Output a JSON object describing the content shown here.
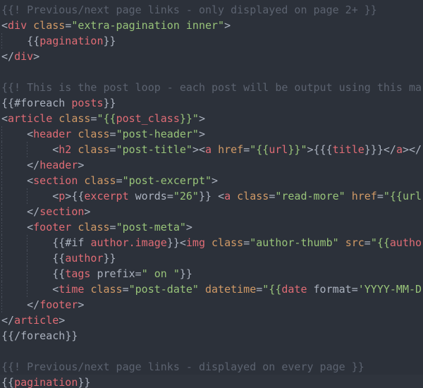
{
  "editor": {
    "theme_name": "one-dark",
    "background": "#2c313a",
    "colors": {
      "comment": "#5c6370",
      "tag": "#e06c75",
      "attribute": "#d19a66",
      "string": "#98c379",
      "punctuation": "#abb2bf",
      "variable": "#e06c75",
      "plain": "#abb2bf",
      "cursor_line": "#2f343d",
      "indent_guide": "#5c6370"
    },
    "language": "handlebars",
    "font_size_px": 15,
    "line_height_px": 22
  },
  "lines": [
    {
      "n": 1,
      "indent": 0,
      "guides": [],
      "cursor_line": false,
      "tokens": [
        {
          "c": "t-comment",
          "s": "{{! Previous/next page links - only displayed on page 2+ }}"
        }
      ]
    },
    {
      "n": 2,
      "indent": 0,
      "guides": [],
      "cursor_line": false,
      "tokens": [
        {
          "c": "t-punct",
          "s": "<"
        },
        {
          "c": "t-tag",
          "s": "div"
        },
        {
          "c": "t-plain",
          "s": " "
        },
        {
          "c": "t-attr",
          "s": "class"
        },
        {
          "c": "t-punct",
          "s": "="
        },
        {
          "c": "t-string",
          "s": "\"extra-pagination inner\""
        },
        {
          "c": "t-punct",
          "s": ">"
        }
      ]
    },
    {
      "n": 3,
      "indent": 1,
      "guides": [
        0
      ],
      "cursor_line": false,
      "tokens": [
        {
          "c": "t-punct",
          "s": "    {{"
        },
        {
          "c": "t-var",
          "s": "pagination"
        },
        {
          "c": "t-punct",
          "s": "}}"
        }
      ]
    },
    {
      "n": 4,
      "indent": 0,
      "guides": [],
      "cursor_line": false,
      "tokens": [
        {
          "c": "t-punct",
          "s": "</"
        },
        {
          "c": "t-tag",
          "s": "div"
        },
        {
          "c": "t-punct",
          "s": ">"
        }
      ]
    },
    {
      "n": 5,
      "indent": 0,
      "guides": [],
      "cursor_line": false,
      "tokens": []
    },
    {
      "n": 6,
      "indent": 0,
      "guides": [],
      "cursor_line": false,
      "tokens": [
        {
          "c": "t-comment",
          "s": "{{! This is the post loop - each post will be output using this ma"
        }
      ]
    },
    {
      "n": 7,
      "indent": 0,
      "guides": [],
      "cursor_line": false,
      "tokens": [
        {
          "c": "t-punct",
          "s": "{{"
        },
        {
          "c": "t-kw",
          "s": "#foreach "
        },
        {
          "c": "t-var",
          "s": "posts"
        },
        {
          "c": "t-punct",
          "s": "}}"
        }
      ]
    },
    {
      "n": 8,
      "indent": 0,
      "guides": [],
      "cursor_line": false,
      "tokens": [
        {
          "c": "t-punct",
          "s": "<"
        },
        {
          "c": "t-tag",
          "s": "article"
        },
        {
          "c": "t-plain",
          "s": " "
        },
        {
          "c": "t-attr",
          "s": "class"
        },
        {
          "c": "t-punct",
          "s": "="
        },
        {
          "c": "t-string",
          "s": "\"{{"
        },
        {
          "c": "t-var",
          "s": "post_class"
        },
        {
          "c": "t-string",
          "s": "}}\""
        },
        {
          "c": "t-punct",
          "s": ">"
        }
      ]
    },
    {
      "n": 9,
      "indent": 1,
      "guides": [
        0
      ],
      "cursor_line": false,
      "tokens": [
        {
          "c": "t-plain",
          "s": "    "
        },
        {
          "c": "t-punct",
          "s": "<"
        },
        {
          "c": "t-tag",
          "s": "header"
        },
        {
          "c": "t-plain",
          "s": " "
        },
        {
          "c": "t-attr",
          "s": "class"
        },
        {
          "c": "t-punct",
          "s": "="
        },
        {
          "c": "t-string",
          "s": "\"post-header\""
        },
        {
          "c": "t-punct",
          "s": ">"
        }
      ]
    },
    {
      "n": 10,
      "indent": 2,
      "guides": [
        0,
        1
      ],
      "cursor_line": false,
      "tokens": [
        {
          "c": "t-plain",
          "s": "        "
        },
        {
          "c": "t-punct",
          "s": "<"
        },
        {
          "c": "t-tag",
          "s": "h2"
        },
        {
          "c": "t-plain",
          "s": " "
        },
        {
          "c": "t-attr",
          "s": "class"
        },
        {
          "c": "t-punct",
          "s": "="
        },
        {
          "c": "t-string",
          "s": "\"post-title\""
        },
        {
          "c": "t-punct",
          "s": "><"
        },
        {
          "c": "t-tag",
          "s": "a"
        },
        {
          "c": "t-plain",
          "s": " "
        },
        {
          "c": "t-attr",
          "s": "href"
        },
        {
          "c": "t-punct",
          "s": "="
        },
        {
          "c": "t-string",
          "s": "\"{{"
        },
        {
          "c": "t-var",
          "s": "url"
        },
        {
          "c": "t-string",
          "s": "}}\""
        },
        {
          "c": "t-punct",
          "s": ">{{{"
        },
        {
          "c": "t-var",
          "s": "title"
        },
        {
          "c": "t-punct",
          "s": "}}}</"
        },
        {
          "c": "t-tag",
          "s": "a"
        },
        {
          "c": "t-punct",
          "s": "></"
        }
      ]
    },
    {
      "n": 11,
      "indent": 1,
      "guides": [
        0
      ],
      "cursor_line": false,
      "tokens": [
        {
          "c": "t-plain",
          "s": "    "
        },
        {
          "c": "t-punct",
          "s": "</"
        },
        {
          "c": "t-tag",
          "s": "header"
        },
        {
          "c": "t-punct",
          "s": ">"
        }
      ]
    },
    {
      "n": 12,
      "indent": 1,
      "guides": [
        0
      ],
      "cursor_line": false,
      "tokens": [
        {
          "c": "t-plain",
          "s": "    "
        },
        {
          "c": "t-punct",
          "s": "<"
        },
        {
          "c": "t-tag",
          "s": "section"
        },
        {
          "c": "t-plain",
          "s": " "
        },
        {
          "c": "t-attr",
          "s": "class"
        },
        {
          "c": "t-punct",
          "s": "="
        },
        {
          "c": "t-string",
          "s": "\"post-excerpt\""
        },
        {
          "c": "t-punct",
          "s": ">"
        }
      ]
    },
    {
      "n": 13,
      "indent": 2,
      "guides": [
        0,
        1
      ],
      "cursor_line": false,
      "tokens": [
        {
          "c": "t-plain",
          "s": "        "
        },
        {
          "c": "t-punct",
          "s": "<"
        },
        {
          "c": "t-tag",
          "s": "p"
        },
        {
          "c": "t-punct",
          "s": ">{{"
        },
        {
          "c": "t-var",
          "s": "excerpt"
        },
        {
          "c": "t-plain",
          "s": " "
        },
        {
          "c": "t-kw",
          "s": "words"
        },
        {
          "c": "t-punct",
          "s": "="
        },
        {
          "c": "t-num",
          "s": "\"26\""
        },
        {
          "c": "t-punct",
          "s": "}}"
        },
        {
          "c": "t-plain",
          "s": " "
        },
        {
          "c": "t-punct",
          "s": "<"
        },
        {
          "c": "t-tag",
          "s": "a"
        },
        {
          "c": "t-plain",
          "s": " "
        },
        {
          "c": "t-attr",
          "s": "class"
        },
        {
          "c": "t-punct",
          "s": "="
        },
        {
          "c": "t-string",
          "s": "\"read-more\""
        },
        {
          "c": "t-plain",
          "s": " "
        },
        {
          "c": "t-attr",
          "s": "href"
        },
        {
          "c": "t-punct",
          "s": "="
        },
        {
          "c": "t-string",
          "s": "\"{{url"
        }
      ]
    },
    {
      "n": 14,
      "indent": 1,
      "guides": [
        0
      ],
      "cursor_line": false,
      "tokens": [
        {
          "c": "t-plain",
          "s": "    "
        },
        {
          "c": "t-punct",
          "s": "</"
        },
        {
          "c": "t-tag",
          "s": "section"
        },
        {
          "c": "t-punct",
          "s": ">"
        }
      ]
    },
    {
      "n": 15,
      "indent": 1,
      "guides": [
        0
      ],
      "cursor_line": false,
      "tokens": [
        {
          "c": "t-plain",
          "s": "    "
        },
        {
          "c": "t-punct",
          "s": "<"
        },
        {
          "c": "t-tag",
          "s": "footer"
        },
        {
          "c": "t-plain",
          "s": " "
        },
        {
          "c": "t-attr",
          "s": "class"
        },
        {
          "c": "t-punct",
          "s": "="
        },
        {
          "c": "t-string",
          "s": "\"post-meta\""
        },
        {
          "c": "t-punct",
          "s": ">"
        }
      ]
    },
    {
      "n": 16,
      "indent": 2,
      "guides": [
        0,
        1
      ],
      "cursor_line": false,
      "tokens": [
        {
          "c": "t-plain",
          "s": "        "
        },
        {
          "c": "t-punct",
          "s": "{{"
        },
        {
          "c": "t-kw",
          "s": "#if "
        },
        {
          "c": "t-var",
          "s": "author.image"
        },
        {
          "c": "t-punct",
          "s": "}}<"
        },
        {
          "c": "t-tag",
          "s": "img"
        },
        {
          "c": "t-plain",
          "s": " "
        },
        {
          "c": "t-attr",
          "s": "class"
        },
        {
          "c": "t-punct",
          "s": "="
        },
        {
          "c": "t-string",
          "s": "\"author-thumb\""
        },
        {
          "c": "t-plain",
          "s": " "
        },
        {
          "c": "t-attr",
          "s": "src"
        },
        {
          "c": "t-punct",
          "s": "="
        },
        {
          "c": "t-string",
          "s": "\"{{"
        },
        {
          "c": "t-var",
          "s": "autho"
        }
      ]
    },
    {
      "n": 17,
      "indent": 2,
      "guides": [
        0,
        1
      ],
      "cursor_line": false,
      "tokens": [
        {
          "c": "t-plain",
          "s": "        "
        },
        {
          "c": "t-punct",
          "s": "{{"
        },
        {
          "c": "t-var",
          "s": "author"
        },
        {
          "c": "t-punct",
          "s": "}}"
        }
      ]
    },
    {
      "n": 18,
      "indent": 2,
      "guides": [
        0,
        1
      ],
      "cursor_line": false,
      "tokens": [
        {
          "c": "t-plain",
          "s": "        "
        },
        {
          "c": "t-punct",
          "s": "{{"
        },
        {
          "c": "t-var",
          "s": "tags"
        },
        {
          "c": "t-plain",
          "s": " "
        },
        {
          "c": "t-kw",
          "s": "prefix"
        },
        {
          "c": "t-punct",
          "s": "="
        },
        {
          "c": "t-string",
          "s": "\" on \""
        },
        {
          "c": "t-punct",
          "s": "}}"
        }
      ]
    },
    {
      "n": 19,
      "indent": 2,
      "guides": [
        0,
        1
      ],
      "cursor_line": false,
      "tokens": [
        {
          "c": "t-plain",
          "s": "        "
        },
        {
          "c": "t-punct",
          "s": "<"
        },
        {
          "c": "t-tag",
          "s": "time"
        },
        {
          "c": "t-plain",
          "s": " "
        },
        {
          "c": "t-attr",
          "s": "class"
        },
        {
          "c": "t-punct",
          "s": "="
        },
        {
          "c": "t-string",
          "s": "\"post-date\""
        },
        {
          "c": "t-plain",
          "s": " "
        },
        {
          "c": "t-attr",
          "s": "datetime"
        },
        {
          "c": "t-punct",
          "s": "="
        },
        {
          "c": "t-string",
          "s": "\"{{"
        },
        {
          "c": "t-var",
          "s": "date"
        },
        {
          "c": "t-plain",
          "s": " "
        },
        {
          "c": "t-kw",
          "s": "format"
        },
        {
          "c": "t-punct",
          "s": "="
        },
        {
          "c": "t-string",
          "s": "'YYYY-MM-D"
        }
      ]
    },
    {
      "n": 20,
      "indent": 1,
      "guides": [
        0
      ],
      "cursor_line": false,
      "tokens": [
        {
          "c": "t-plain",
          "s": "    "
        },
        {
          "c": "t-punct",
          "s": "</"
        },
        {
          "c": "t-tag",
          "s": "footer"
        },
        {
          "c": "t-punct",
          "s": ">"
        }
      ]
    },
    {
      "n": 21,
      "indent": 0,
      "guides": [],
      "cursor_line": false,
      "tokens": [
        {
          "c": "t-punct",
          "s": "</"
        },
        {
          "c": "t-tag",
          "s": "article"
        },
        {
          "c": "t-punct",
          "s": ">"
        }
      ]
    },
    {
      "n": 22,
      "indent": 0,
      "guides": [],
      "cursor_line": false,
      "tokens": [
        {
          "c": "t-punct",
          "s": "{{"
        },
        {
          "c": "t-kw",
          "s": "/foreach"
        },
        {
          "c": "t-punct",
          "s": "}}"
        }
      ]
    },
    {
      "n": 23,
      "indent": 0,
      "guides": [],
      "cursor_line": false,
      "tokens": []
    },
    {
      "n": 24,
      "indent": 0,
      "guides": [],
      "cursor_line": false,
      "tokens": [
        {
          "c": "t-comment",
          "s": "{{! Previous/next page links - displayed on every page }}"
        }
      ]
    },
    {
      "n": 25,
      "indent": 0,
      "guides": [],
      "cursor_line": true,
      "tokens": [
        {
          "c": "t-punct",
          "s": "{{"
        },
        {
          "c": "t-var",
          "s": "pagination"
        },
        {
          "c": "t-punct",
          "s": "}}"
        }
      ]
    }
  ]
}
